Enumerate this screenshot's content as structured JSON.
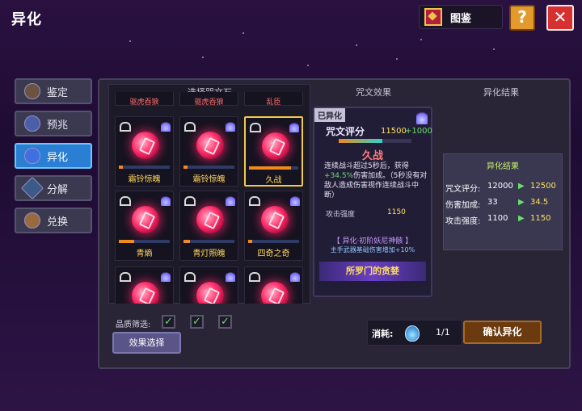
{
  "header": {
    "title": "异化",
    "codex_label": "图鉴",
    "help_label": "?",
    "close_label": "✕"
  },
  "sidebar": {
    "items": [
      {
        "label": "鉴定",
        "active": false
      },
      {
        "label": "预兆",
        "active": false
      },
      {
        "label": "异化",
        "active": true
      },
      {
        "label": "分解",
        "active": false
      },
      {
        "label": "兑换",
        "active": false
      }
    ]
  },
  "sections": {
    "select_rune": "选择咒文石",
    "rune_effect": "咒文效果",
    "evolve_result": "异化结果"
  },
  "rune_cards": [
    {
      "top_label": "驱虎吞狼",
      "name": "",
      "progress": 0,
      "lock": false,
      "selected": false
    },
    {
      "top_label": "驱虎吞狼",
      "name": "",
      "progress": 0,
      "lock": false,
      "selected": false
    },
    {
      "top_label": "乱臣",
      "name": "",
      "progress": 0,
      "lock": false,
      "selected": false
    },
    {
      "top_label": "",
      "name": "霜铃惊魄",
      "progress": 0.08,
      "lock": true,
      "selected": false
    },
    {
      "top_label": "",
      "name": "霜铃惊魄",
      "progress": 0.08,
      "lock": true,
      "selected": false
    },
    {
      "top_label": "",
      "name": "久战",
      "progress": 0.85,
      "lock": false,
      "selected": true
    },
    {
      "top_label": "",
      "name": "青熵",
      "progress": 0.3,
      "lock": false,
      "selected": false
    },
    {
      "top_label": "",
      "name": "青灯照魄",
      "progress": 0.12,
      "lock": false,
      "selected": false
    },
    {
      "top_label": "",
      "name": "四奇之奇",
      "progress": 0.08,
      "lock": false,
      "selected": false
    },
    {
      "top_label": "",
      "name": "",
      "progress": 0,
      "lock": false,
      "selected": false
    },
    {
      "top_label": "",
      "name": "",
      "progress": 0,
      "lock": false,
      "selected": false
    },
    {
      "top_label": "",
      "name": "",
      "progress": 0,
      "lock": false,
      "selected": false
    }
  ],
  "detail": {
    "tag": "已异化",
    "score_label": "咒文评分",
    "score_base": "11500",
    "score_bonus": "+1000",
    "score_progress": 0.6,
    "rune_name": "久战",
    "desc_pre": "连续战斗超过5秒后，获得",
    "desc_hl": "+34.5%",
    "desc_post": "伤害加成。（5秒没有对敌人造成伤害视作连续战斗中断）",
    "atk_label": "攻击强度",
    "atk_value": "1150",
    "bonus_title": "【 异化·初阶妖尼神骸 】",
    "bonus_desc": "主手武器基础伤害增加+10%",
    "set_name": "所罗门的贪婪"
  },
  "result": {
    "title": "异化结果",
    "rows": [
      {
        "label": "咒文评分:",
        "from": "12000",
        "arrow": "▶",
        "to": "12500"
      },
      {
        "label": "伤害加成:",
        "from": "33",
        "arrow": "▶",
        "to": "34.5"
      },
      {
        "label": "攻击强度:",
        "from": "1100",
        "arrow": "▶",
        "to": "1150"
      }
    ]
  },
  "filter": {
    "label": "品质筛选:",
    "checks": [
      true,
      true,
      true
    ],
    "check_glyph": "✓"
  },
  "buttons": {
    "effect_select": "效果选择",
    "confirm": "确认异化"
  },
  "cost": {
    "label": "消耗:",
    "value": "1/1"
  }
}
